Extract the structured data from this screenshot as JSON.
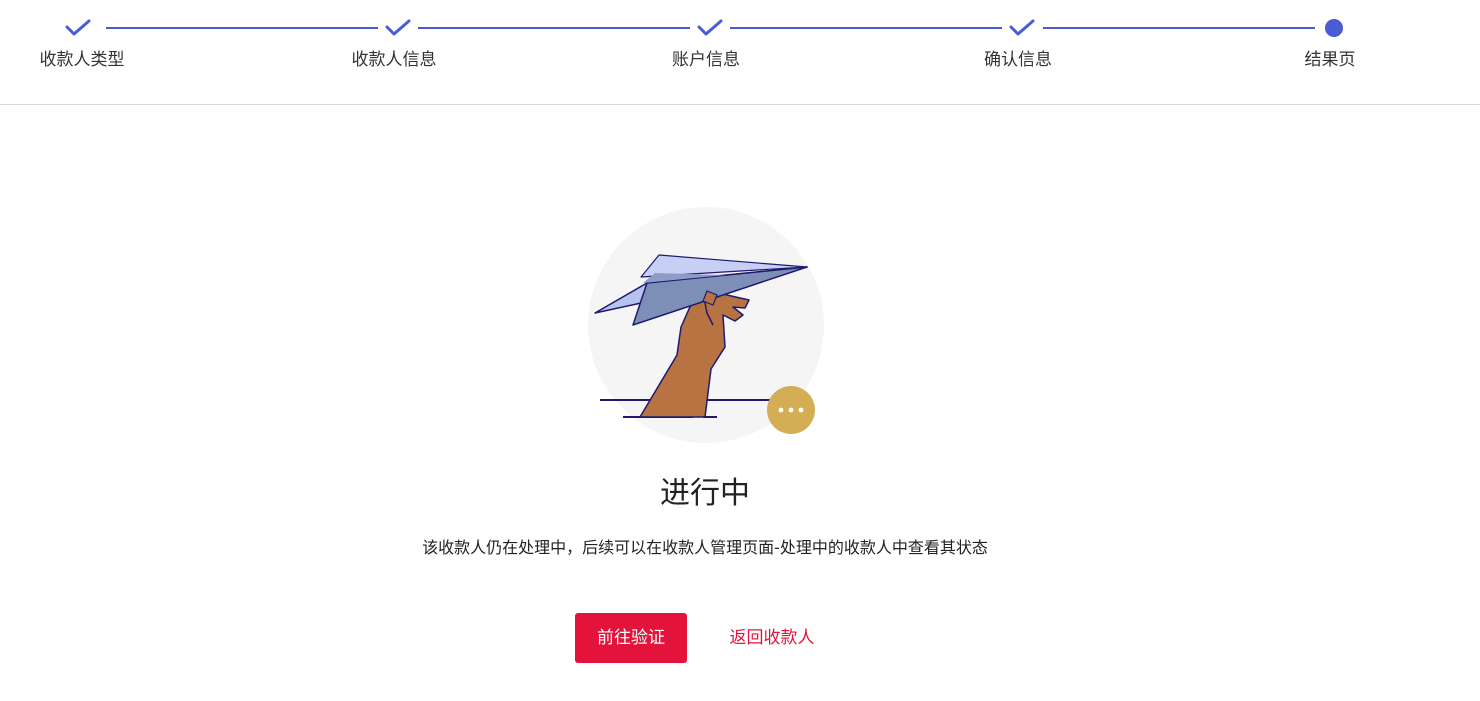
{
  "colors": {
    "accent": "#4a5bd4",
    "primary_button": "#e4133b",
    "link": "#e4133b",
    "badge": "#d4ae55",
    "illustration_bg": "#f5f5f5"
  },
  "steps": [
    {
      "label": "收款人类型",
      "state": "done",
      "icon": "check-icon"
    },
    {
      "label": "收款人信息",
      "state": "done",
      "icon": "check-icon"
    },
    {
      "label": "账户信息",
      "state": "done",
      "icon": "check-icon"
    },
    {
      "label": "确认信息",
      "state": "done",
      "icon": "check-icon"
    },
    {
      "label": "结果页",
      "state": "current",
      "icon": "current-step-dot"
    }
  ],
  "result": {
    "illustration_icon": "paper-plane-hand-icon",
    "badge_icon": "ellipsis-icon",
    "title": "进行中",
    "description": "该收款人仍在处理中，后续可以在收款人管理页面-处理中的收款人中查看其状态"
  },
  "actions": {
    "primary_label": "前往验证",
    "secondary_label": "返回收款人"
  }
}
